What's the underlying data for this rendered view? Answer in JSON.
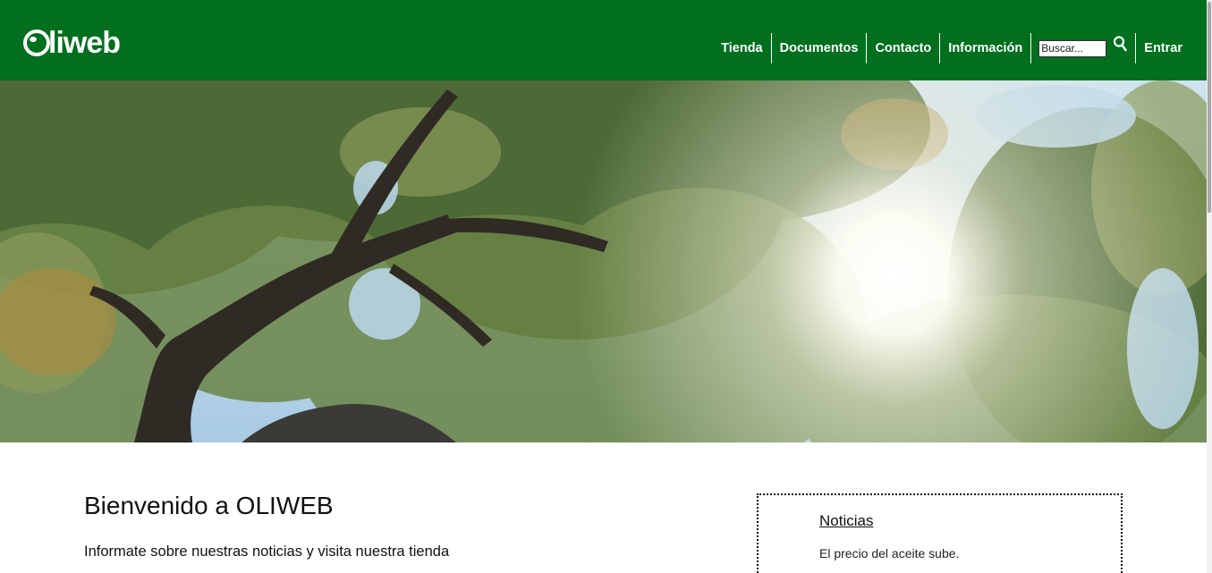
{
  "header": {
    "logo_text": "liweb",
    "bg_color": "#006f1e",
    "nav": {
      "items": [
        "Tienda",
        "Documentos",
        "Contacto",
        "Información"
      ],
      "search_placeholder": "Buscar...",
      "search_icon": "search-icon",
      "login_label": "Entrar"
    }
  },
  "hero": {
    "description_icon": "olive-trees-hero-image"
  },
  "main": {
    "title": "Bienvenido a OLIWEB",
    "subtitle": "Informate sobre nuestras noticias y visita nuestra tienda"
  },
  "news": {
    "title": "Noticias",
    "items": [
      "El precio del aceite sube."
    ]
  }
}
